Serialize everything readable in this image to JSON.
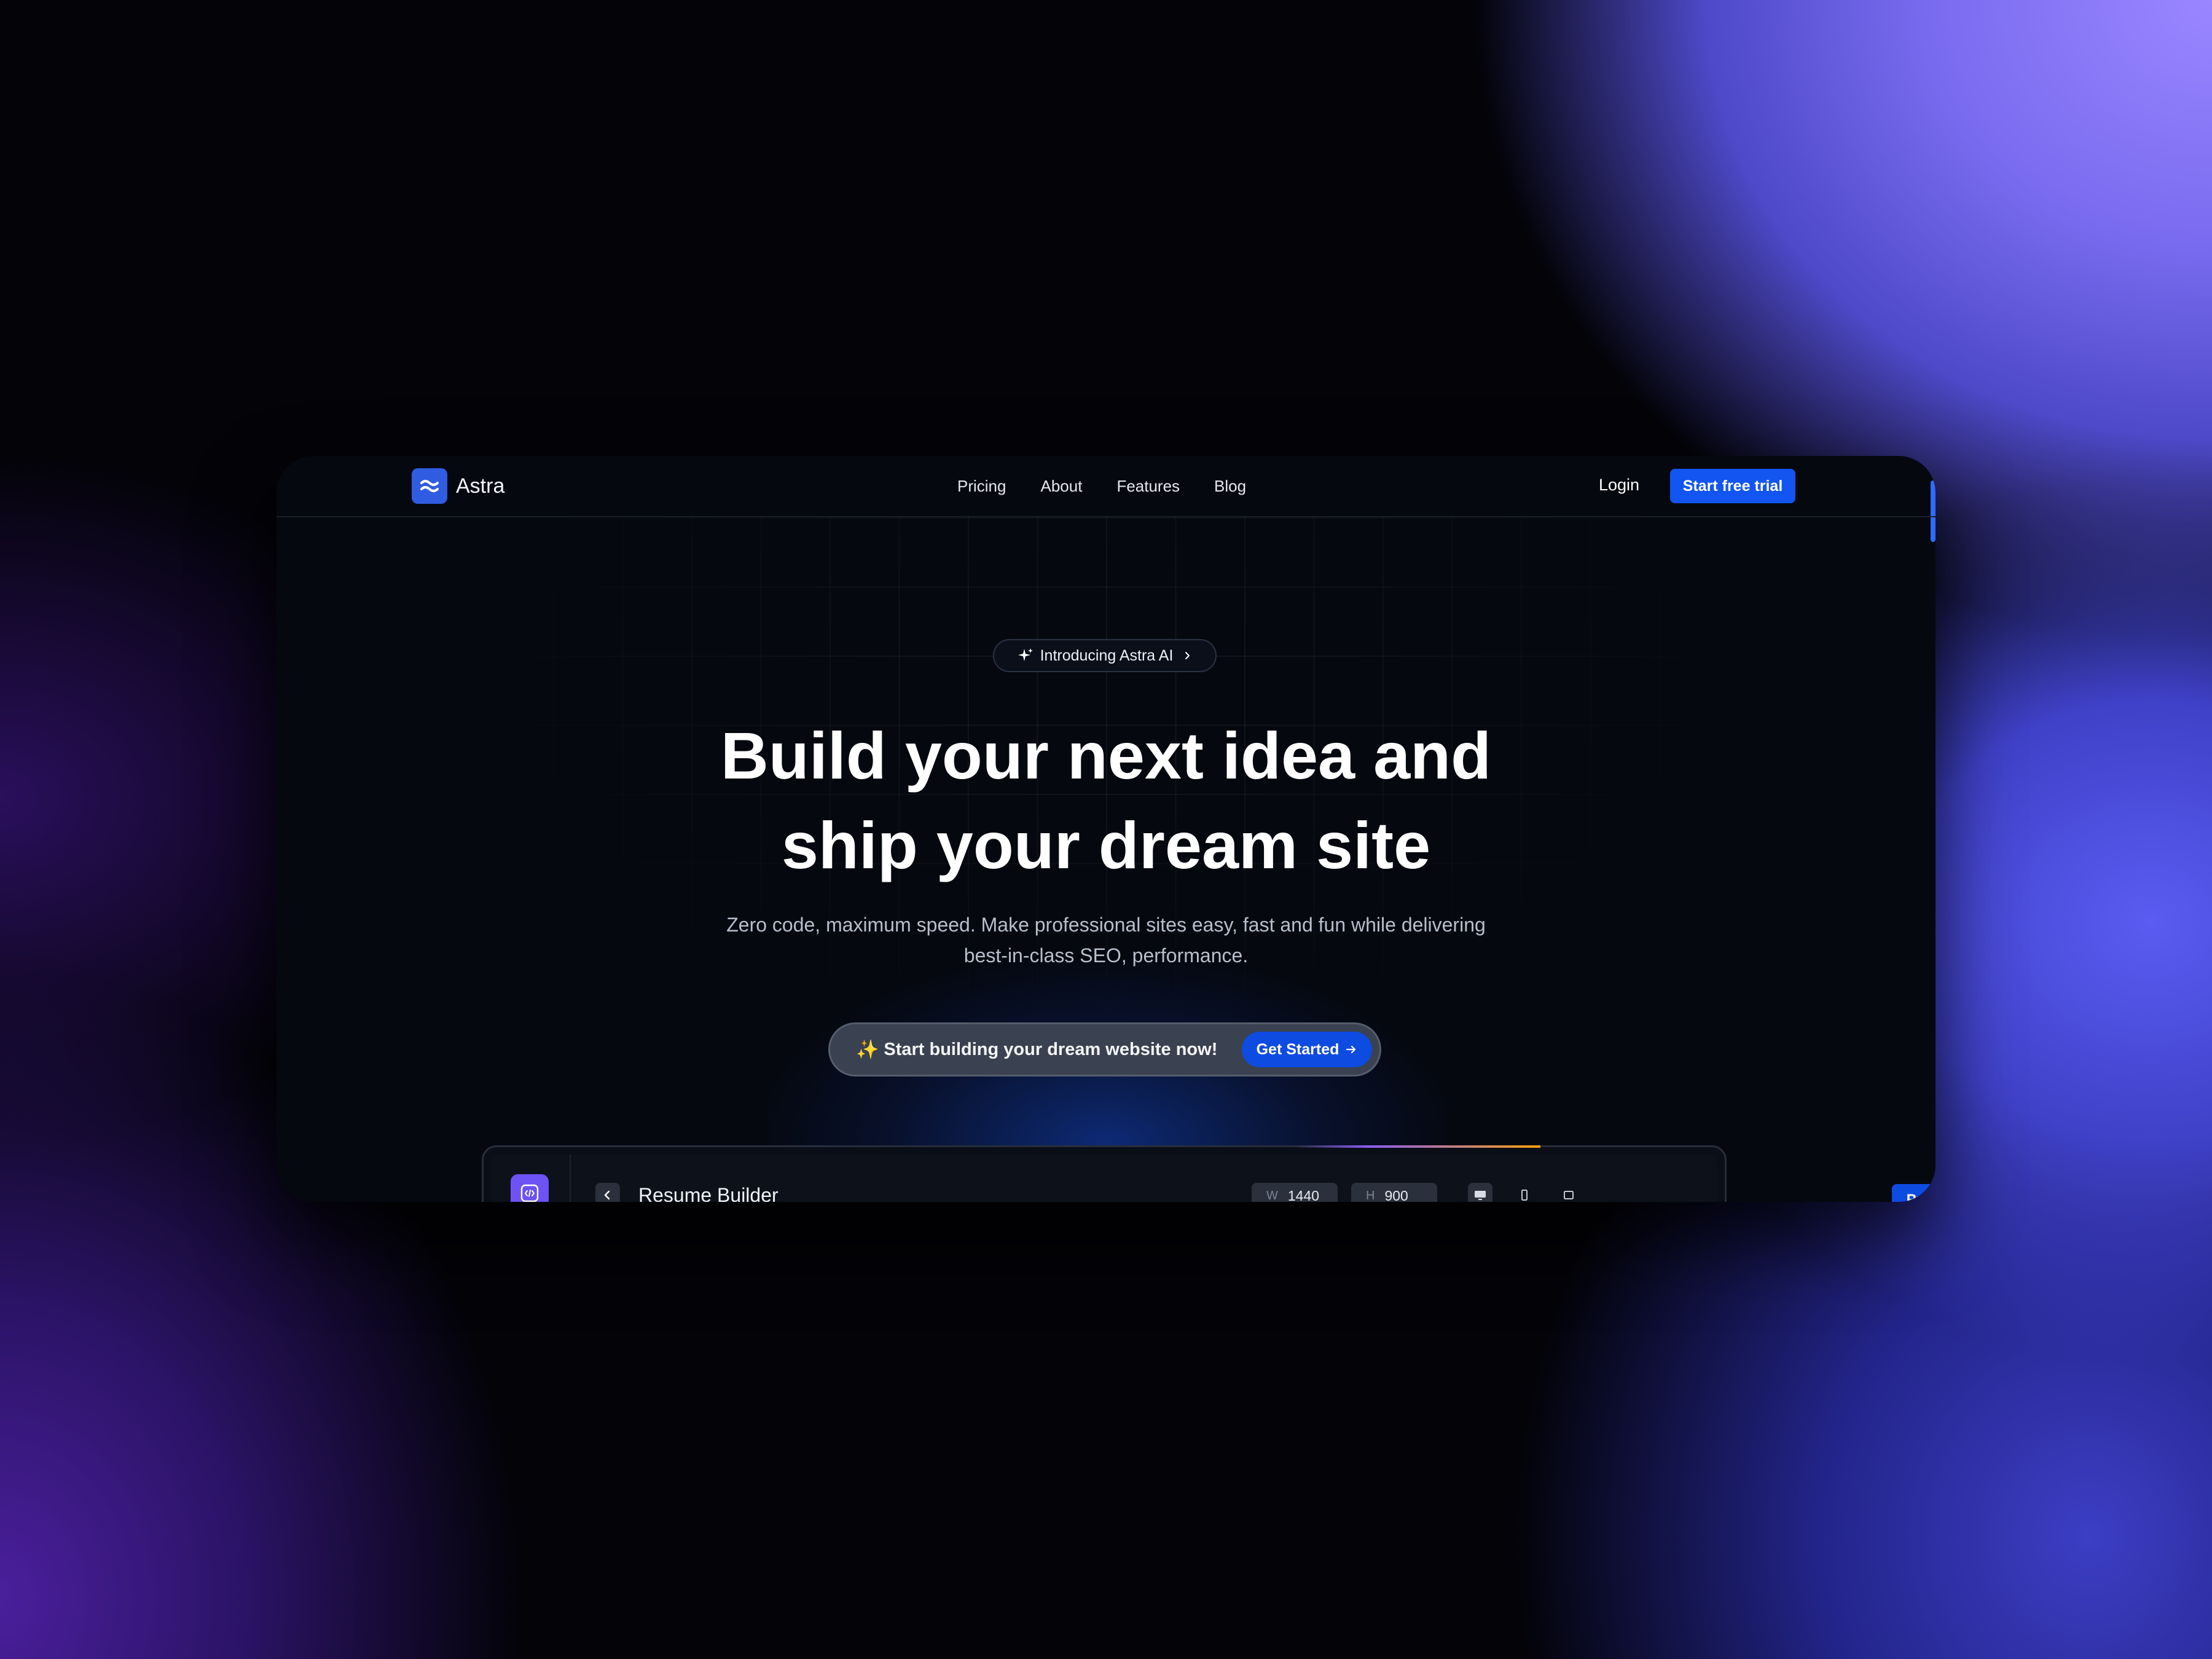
{
  "brand": {
    "name": "Astra"
  },
  "nav": {
    "links": [
      "Pricing",
      "About",
      "Features",
      "Blog"
    ]
  },
  "header": {
    "login_label": "Login",
    "trial_label": "Start free trial"
  },
  "hero": {
    "pill_label": "Introducing Astra AI",
    "headline_line1": "Build your next idea and",
    "headline_line2": "ship your dream site",
    "subtext_line1": "Zero code, maximum speed. Make professional sites easy, fast and fun while delivering",
    "subtext_line2": "best-in-class SEO, performance.",
    "cta_text": "Start building your dream website now!",
    "cta_emoji": "✨",
    "cta_button": "Get Started"
  },
  "builder": {
    "project_title": "Resume Builder",
    "width_label": "W",
    "width_value": "1440",
    "height_label": "H",
    "height_value": "900",
    "publish_label": "Publish",
    "device_icons": [
      "desktop-icon",
      "mobile-icon",
      "tablet-icon"
    ]
  },
  "colors": {
    "accent": "#1255f0",
    "app_icon": "#6d52f5",
    "page_bg": "#05080f"
  }
}
